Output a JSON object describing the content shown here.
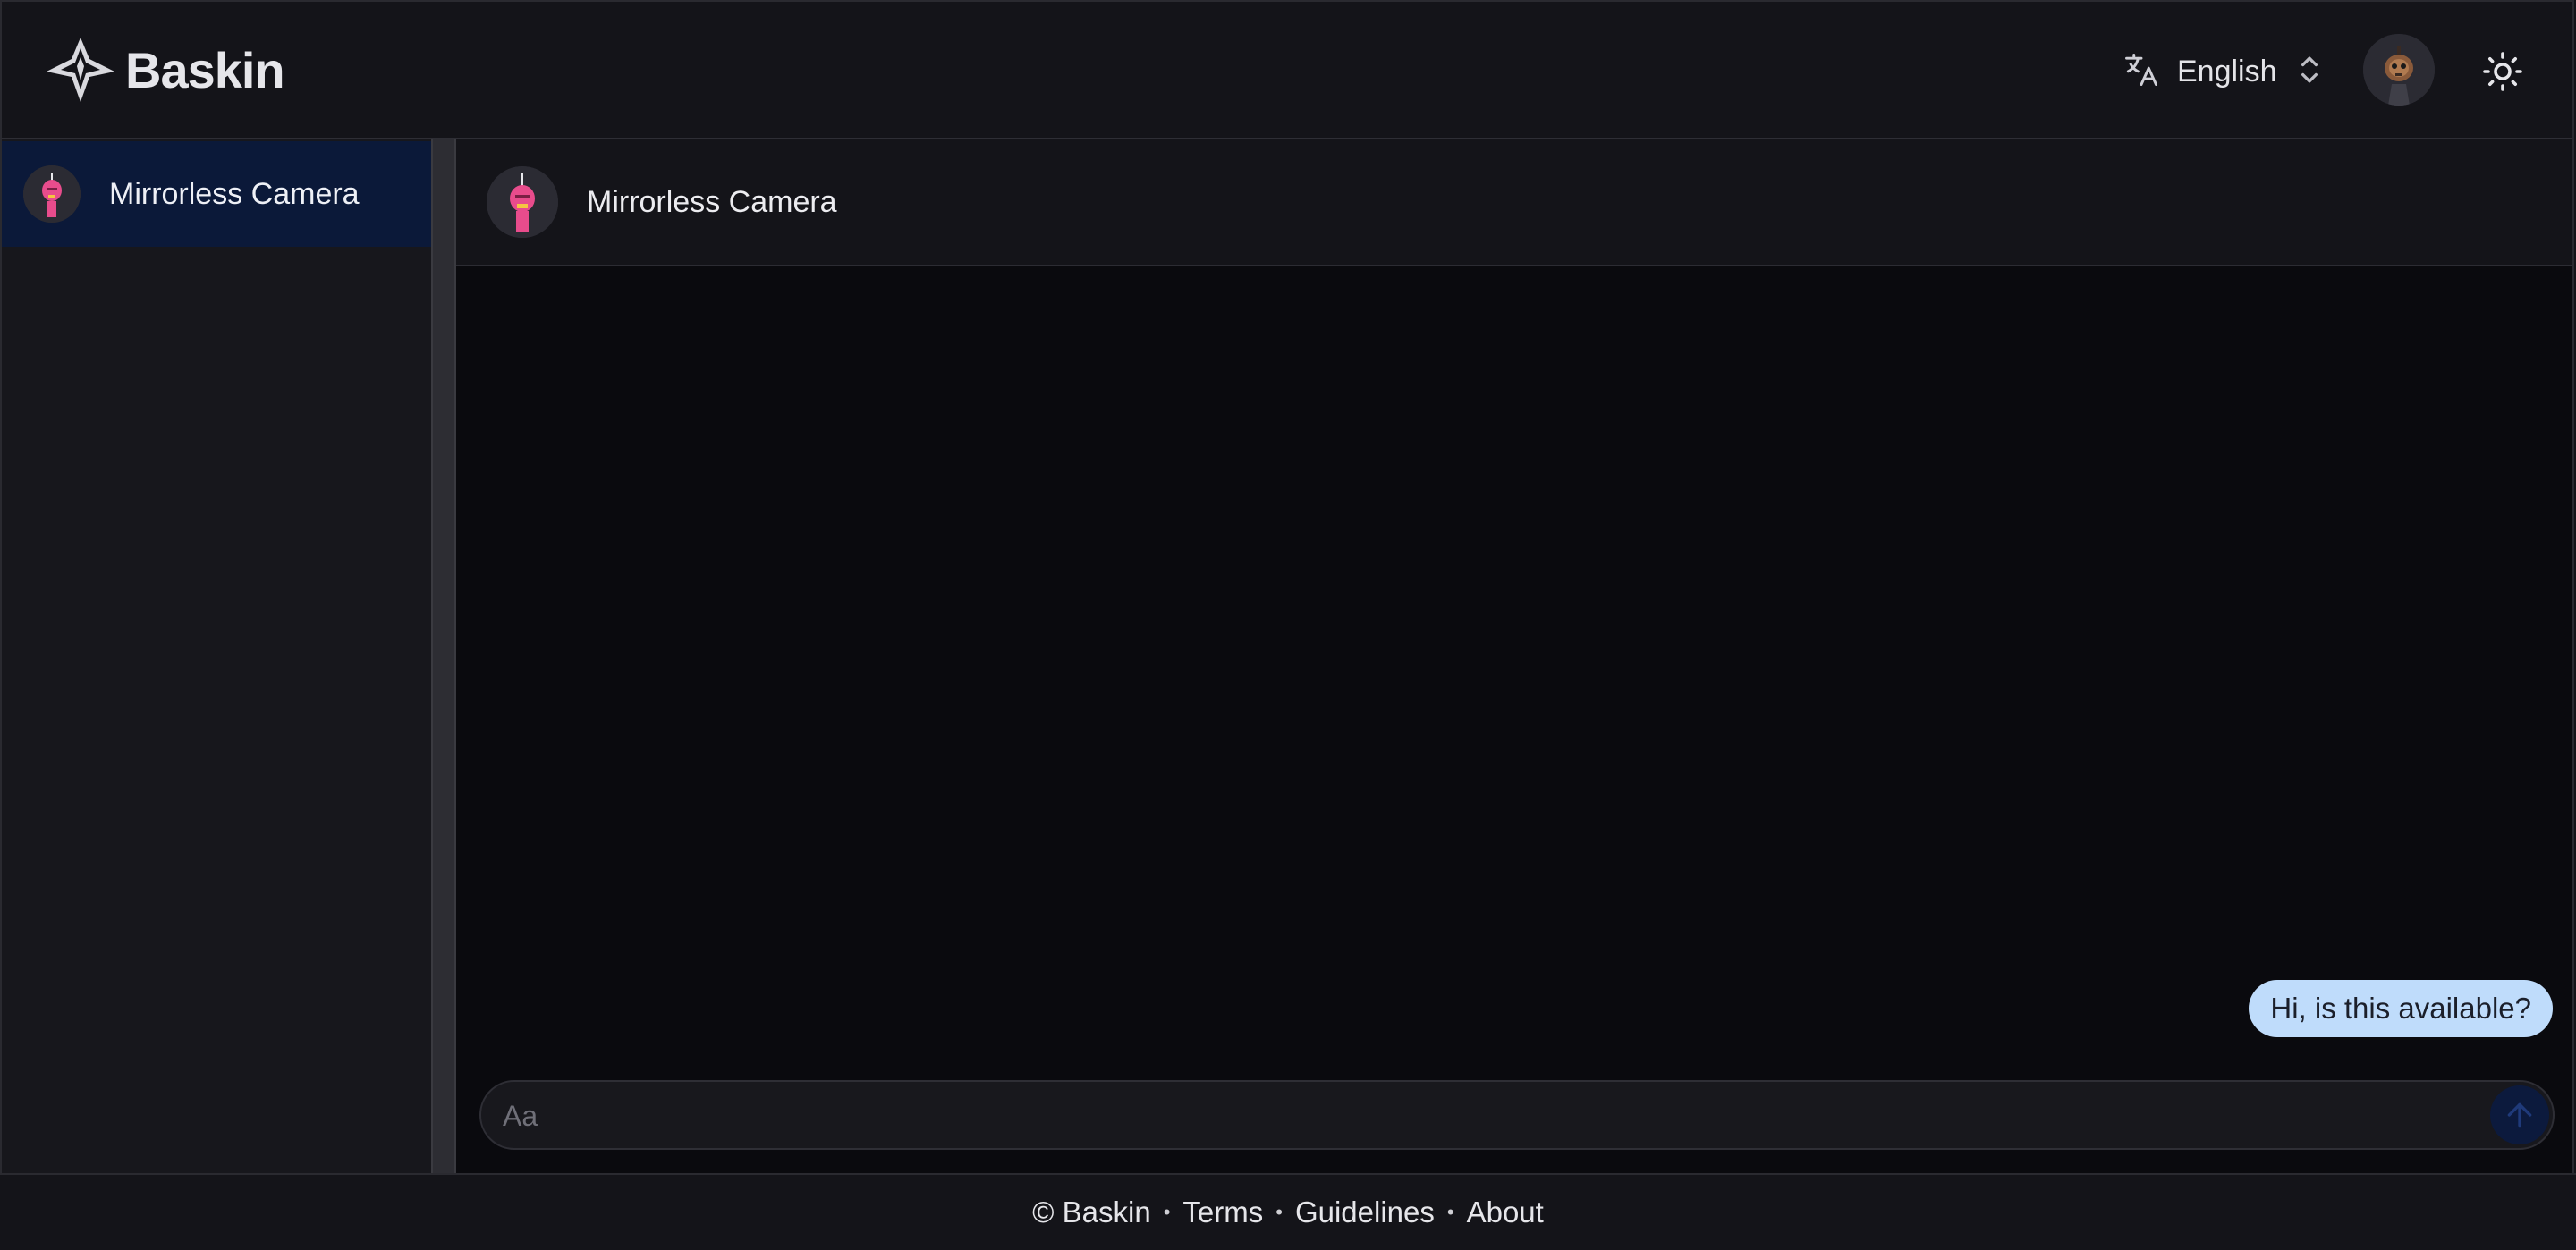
{
  "header": {
    "brand": "Baskin",
    "language_label": "English"
  },
  "sidebar": {
    "conversations": [
      {
        "label": "Mirrorless Camera",
        "selected": true
      }
    ]
  },
  "chat": {
    "title": "Mirrorless Camera",
    "messages": [
      {
        "text": "Hi, is this available?",
        "from": "me"
      }
    ],
    "composer_placeholder": "Aa"
  },
  "footer": {
    "copyright": "© Baskin",
    "links": [
      "Terms",
      "Guidelines",
      "About"
    ]
  },
  "colors": {
    "background": "#141419",
    "chat_background": "#0a0a0e",
    "selected_item": "#0b1939",
    "bubble": "#bfdcfb",
    "send_button": "#0c1a3d",
    "avatar_accent": "#e84c8c"
  },
  "icons": {
    "logo": "baskin-logo-icon",
    "language": "translate-icon",
    "language_dropdown": "chevron-up-down-icon",
    "theme": "sun-icon",
    "send": "arrow-up-icon"
  }
}
